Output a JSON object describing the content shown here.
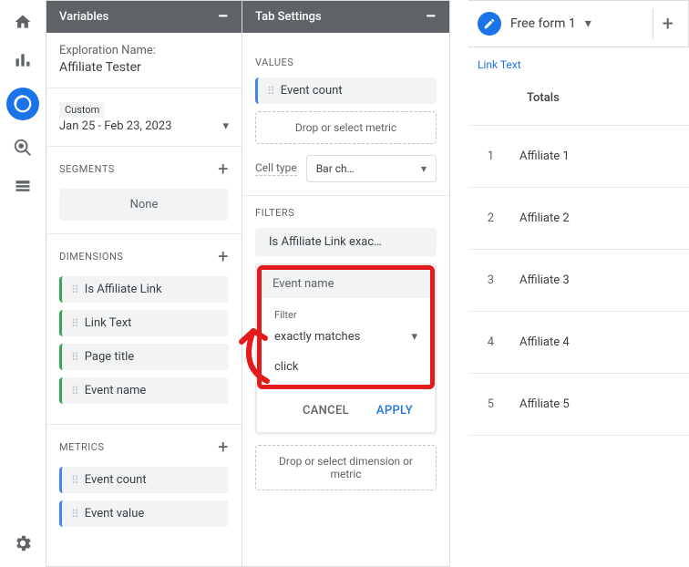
{
  "panels": {
    "variables_title": "Variables",
    "tabsettings_title": "Tab Settings"
  },
  "exploration": {
    "label": "Exploration Name:",
    "name": "Affiliate Tester",
    "custom": "Custom",
    "range": "Jan 25 - Feb 23, 2023"
  },
  "segments": {
    "title": "SEGMENTS",
    "none": "None"
  },
  "dimensions": {
    "title": "DIMENSIONS",
    "items": [
      "Is Affiliate Link",
      "Link Text",
      "Page title",
      "Event name"
    ]
  },
  "metrics": {
    "title": "METRICS",
    "items": [
      "Event count",
      "Event value"
    ]
  },
  "values": {
    "title": "VALUES",
    "items": [
      "Event count"
    ],
    "drop": "Drop or select metric"
  },
  "celltype": {
    "label": "Cell type",
    "value": "Bar ch…"
  },
  "filters": {
    "title": "FILTERS",
    "chips": [
      "Is Affiliate Link exac…"
    ],
    "editing": {
      "field": "Event name",
      "filter_label": "Filter",
      "condition": "exactly matches",
      "value": "click",
      "cancel": "CANCEL",
      "apply": "APPLY"
    },
    "drop": "Drop or select dimension or metric"
  },
  "preview": {
    "tab_name": "Free form 1",
    "dim_label": "Link Text",
    "totals": "Totals",
    "rows": [
      {
        "n": "1",
        "label": "Affiliate 1"
      },
      {
        "n": "2",
        "label": "Affiliate 2"
      },
      {
        "n": "3",
        "label": "Affiliate 3"
      },
      {
        "n": "4",
        "label": "Affiliate 4"
      },
      {
        "n": "5",
        "label": "Affiliate 5"
      }
    ]
  }
}
